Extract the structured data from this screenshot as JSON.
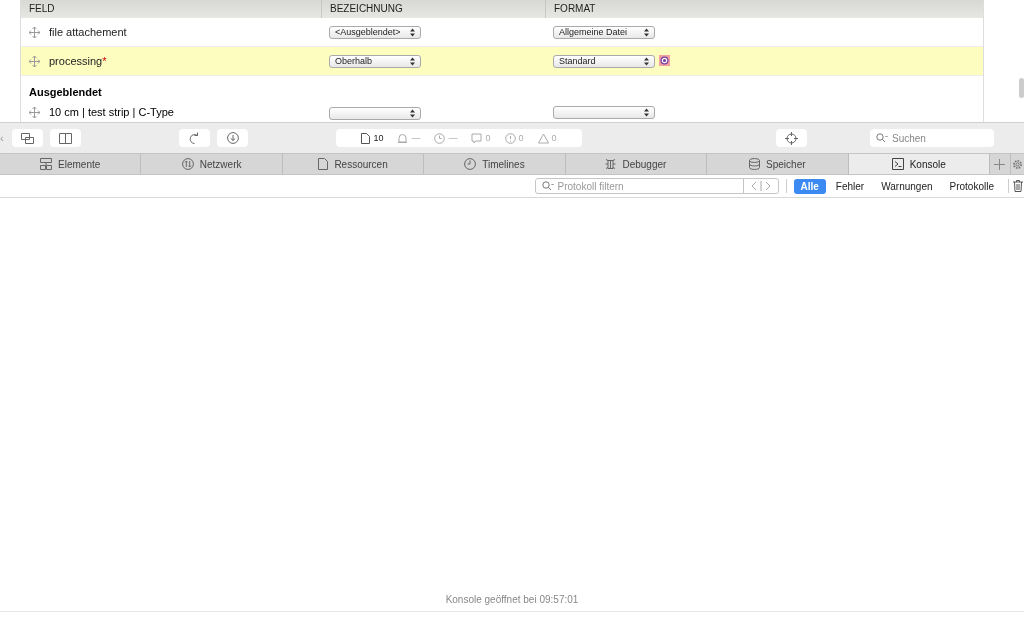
{
  "table": {
    "columns": [
      "FELD",
      "BEZEICHNUNG",
      "FORMAT"
    ],
    "rows": [
      {
        "field": "file attachement",
        "highlighted": false,
        "label_select": "<Ausgeblendet>",
        "format_select": "Allgemeine Datei",
        "changed": false
      },
      {
        "field": "processing",
        "required_mark": "*",
        "highlighted": true,
        "label_select": "Oberhalb",
        "format_select": "Standard",
        "changed": true
      }
    ],
    "section": "Ausgeblendet",
    "partial_row": {
      "field": "10 cm | test strip | C-Type"
    }
  },
  "toolbar": {
    "edge_glyph": "‹",
    "dashboard": [
      "10",
      "—",
      "—",
      "0",
      "0",
      "0"
    ],
    "search": {
      "placeholder": "Suchen"
    }
  },
  "tabs": [
    {
      "label": "Elemente",
      "selected": false
    },
    {
      "label": "Netzwerk",
      "selected": false
    },
    {
      "label": "Ressourcen",
      "selected": false
    },
    {
      "label": "Timelines",
      "selected": false
    },
    {
      "label": "Debugger",
      "selected": false
    },
    {
      "label": "Speicher",
      "selected": false
    },
    {
      "label": "Konsole",
      "selected": true
    }
  ],
  "filter": {
    "placeholder": "Protokoll filtern",
    "levels": [
      {
        "label": "Alle",
        "selected": true
      },
      {
        "label": "Fehler",
        "selected": false
      },
      {
        "label": "Warnungen",
        "selected": false
      },
      {
        "label": "Protokolle",
        "selected": false
      }
    ]
  },
  "console": {
    "message": "Konsole geöffnet bei 09:57:01"
  }
}
